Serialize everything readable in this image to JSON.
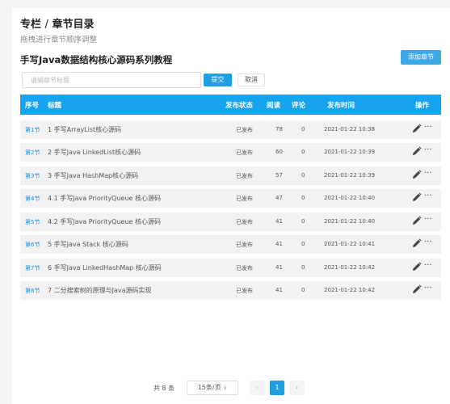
{
  "header": {
    "breadcrumb_section": "专栏",
    "breadcrumb_sep": "/",
    "breadcrumb_current": "章节目录",
    "subtitle": "拖拽进行章节顺序调整"
  },
  "series": {
    "title": "手写Java数据结构核心源码系列教程",
    "add_button": "添加章节"
  },
  "form": {
    "placeholder": "请输章节标题",
    "submit_label": "提交",
    "cancel_label": "取消"
  },
  "table": {
    "columns": {
      "index": "序号",
      "title": "标题",
      "status": "发布状态",
      "views": "阅读",
      "comments": "评论",
      "time": "发布时间",
      "actions": "操作"
    },
    "rows": [
      {
        "index": "第1节",
        "title": "1 手写ArrayList核心源码",
        "status": "已发布",
        "views": "78",
        "comments": "0",
        "time": "2021-01-22 10:38"
      },
      {
        "index": "第2节",
        "title": "2 手写Java LinkedList核心源码",
        "status": "已发布",
        "views": "60",
        "comments": "0",
        "time": "2021-01-22 10:39"
      },
      {
        "index": "第3节",
        "title": "3 手写Java HashMap核心源码",
        "status": "已发布",
        "views": "57",
        "comments": "0",
        "time": "2021-01-22 10:39"
      },
      {
        "index": "第4节",
        "title": "4.1 手写Java PriorityQueue 核心源码",
        "status": "已发布",
        "views": "47",
        "comments": "0",
        "time": "2021-01-22 10:40"
      },
      {
        "index": "第5节",
        "title": "4.2 手写Java PriorityQueue 核心源码",
        "status": "已发布",
        "views": "41",
        "comments": "0",
        "time": "2021-01-22 10:40"
      },
      {
        "index": "第6节",
        "title": "5 手写Java Stack 核心源码",
        "status": "已发布",
        "views": "41",
        "comments": "0",
        "time": "2021-01-22 10:41"
      },
      {
        "index": "第7节",
        "title": "6 手写Java LinkedHashMap 核心源码",
        "status": "已发布",
        "views": "41",
        "comments": "0",
        "time": "2021-01-22 10:42"
      },
      {
        "index": "第8节",
        "title": "7 二分搜索树的原理与Java源码实现",
        "status": "已发布",
        "views": "41",
        "comments": "0",
        "time": "2021-01-22 10:42"
      }
    ],
    "more_glyph": "···"
  },
  "pagination": {
    "total": "共 8 条",
    "page_size": "15条/页",
    "page_size_arrow": "∨",
    "prev": "‹",
    "current_page": "1",
    "next": "›"
  },
  "colors": {
    "accent": "#1e9fe0",
    "table_header": "#17a3ee",
    "row_bg": "#f2f2f2"
  },
  "icons": {
    "edit": "pencil-icon",
    "more": "more-dots-icon"
  }
}
